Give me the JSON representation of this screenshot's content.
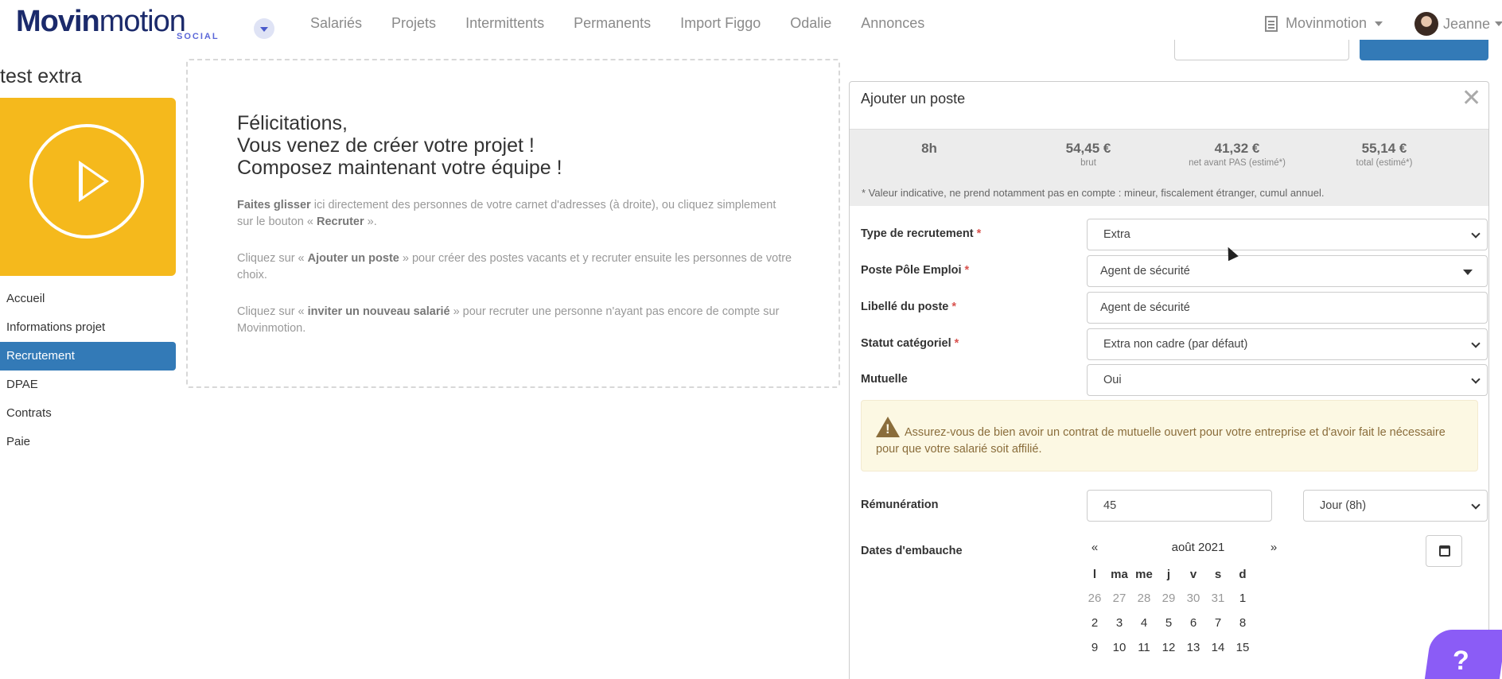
{
  "brand": {
    "logo_main_bold": "Movin",
    "logo_main_rest": "motion",
    "logo_sub": "SOCIAL"
  },
  "nav": {
    "items": [
      "Salariés",
      "Projets",
      "Intermittents",
      "Permanents",
      "Import Figgo",
      "Odalie",
      "Annonces"
    ]
  },
  "org": {
    "name": "Movinmotion"
  },
  "user": {
    "name": "Jeanne"
  },
  "project": {
    "title": "test extra"
  },
  "sidebar": {
    "items": [
      {
        "label": "Accueil",
        "active": false
      },
      {
        "label": "Informations projet",
        "active": false
      },
      {
        "label": "Recrutement",
        "active": true
      },
      {
        "label": "DPAE",
        "active": false
      },
      {
        "label": "Contrats",
        "active": false
      },
      {
        "label": "Paie",
        "active": false
      }
    ]
  },
  "welcome": {
    "line1": "Félicitations,",
    "line2": "Vous venez de créer votre projet !",
    "line3": "Composez maintenant votre équipe !",
    "p1_bold": "Faites glisser",
    "p1_text": " ici directement des personnes de votre carnet d'adresses (à droite), ou cliquez simplement sur le bouton « ",
    "p1_bold2": "Recruter",
    "p1_end": " ».",
    "p2_pre": "Cliquez sur « ",
    "p2_bold": "Ajouter un poste",
    "p2_text": " » pour créer des postes vacants et y recruter ensuite les personnes de votre choix.",
    "p3_pre": "Cliquez sur « ",
    "p3_bold": "inviter un nouveau salarié",
    "p3_text": " » pour recruter une personne n'ayant pas encore de compte sur Movinmotion."
  },
  "panel": {
    "title": "Ajouter un poste",
    "close": "✕",
    "summary": [
      {
        "value": "8h",
        "label": ""
      },
      {
        "value": "54,45 €",
        "label": "brut"
      },
      {
        "value": "41,32 €",
        "label": "net avant PAS (estimé*)"
      },
      {
        "value": "55,14 €",
        "label": "total (estimé*)"
      }
    ],
    "note": "* Valeur indicative, ne prend notamment pas en compte : mineur, fiscalement étranger, cumul annuel.",
    "fields": {
      "type_label": "Type de recrutement",
      "type_value": "Extra",
      "poste_label": "Poste Pôle Emploi",
      "poste_value": "Agent de sécurité",
      "libelle_label": "Libellé du poste",
      "libelle_value": "Agent de sécurité",
      "statut_label": "Statut catégoriel",
      "statut_value": "Extra non cadre (par défaut)",
      "mutuelle_label": "Mutuelle",
      "mutuelle_value": "Oui",
      "remun_label": "Rémunération",
      "remun_value": "45",
      "remun_unit": "Jour (8h)",
      "dates_label": "Dates d'embauche"
    },
    "required_mark": "*",
    "alert": "Assurez-vous de bien avoir un contrat de mutuelle ouvert pour votre entreprise et d'avoir fait le nécessaire pour que votre salarié soit affilié."
  },
  "calendar": {
    "prev": "«",
    "month": "août 2021",
    "next": "»",
    "dow": [
      "l",
      "ma",
      "me",
      "j",
      "v",
      "s",
      "d"
    ],
    "weeks": [
      [
        {
          "d": "26",
          "m": true
        },
        {
          "d": "27",
          "m": true
        },
        {
          "d": "28",
          "m": true
        },
        {
          "d": "29",
          "m": true
        },
        {
          "d": "30",
          "m": true
        },
        {
          "d": "31",
          "m": true
        },
        {
          "d": "1",
          "m": false
        }
      ],
      [
        {
          "d": "2",
          "m": false
        },
        {
          "d": "3",
          "m": false
        },
        {
          "d": "4",
          "m": false
        },
        {
          "d": "5",
          "m": false
        },
        {
          "d": "6",
          "m": false
        },
        {
          "d": "7",
          "m": false
        },
        {
          "d": "8",
          "m": false
        }
      ],
      [
        {
          "d": "9",
          "m": false
        },
        {
          "d": "10",
          "m": false
        },
        {
          "d": "11",
          "m": false
        },
        {
          "d": "12",
          "m": false
        },
        {
          "d": "13",
          "m": false
        },
        {
          "d": "14",
          "m": false
        },
        {
          "d": "15",
          "m": false
        }
      ]
    ]
  },
  "help": {
    "label": "?"
  }
}
